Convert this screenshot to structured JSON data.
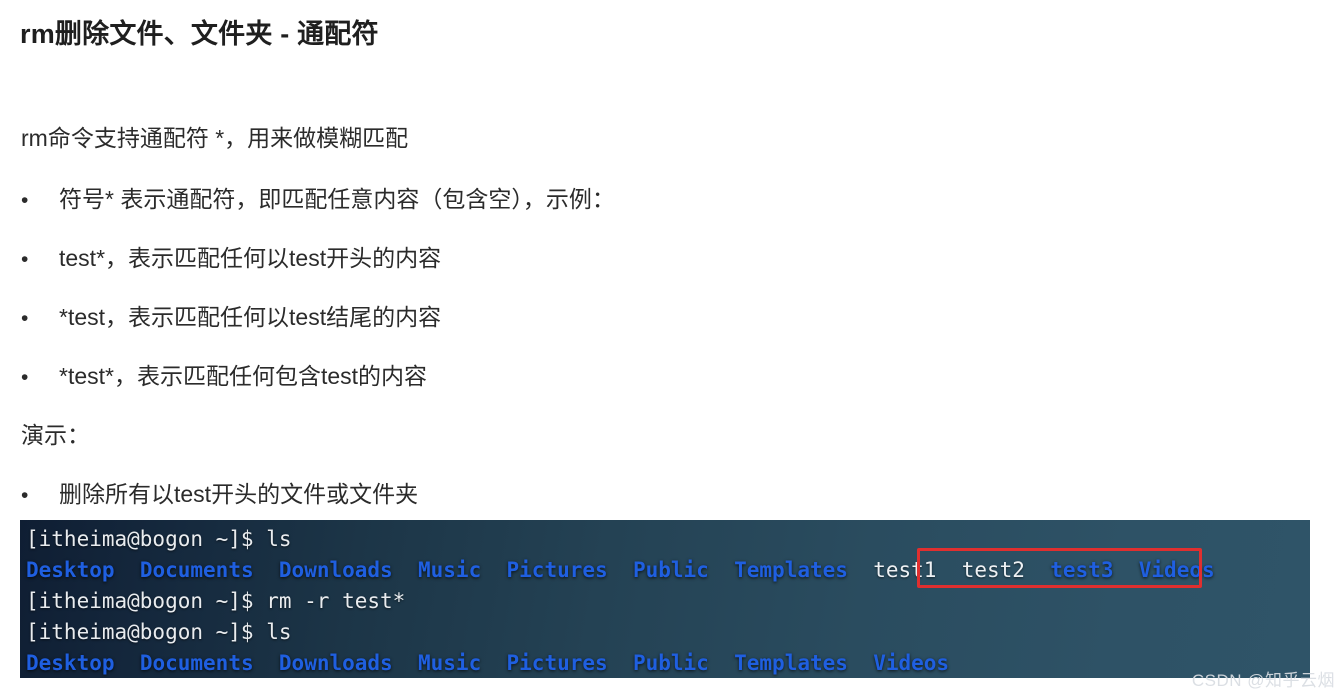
{
  "page": {
    "title": "rm删除文件、文件夹 - 通配符",
    "intro": "rm命令支持通配符 *，用来做模糊匹配",
    "bullets": [
      {
        "marker": "•",
        "text": "符号* 表示通配符，即匹配任意内容（包含空），示例："
      },
      {
        "marker": "•",
        "text": "test*，表示匹配任何以test开头的内容"
      },
      {
        "marker": "•",
        "text": "*test，表示匹配任何以test结尾的内容"
      },
      {
        "marker": "•",
        "text": "*test*，表示匹配任何包含test的内容"
      }
    ],
    "demo_label": "演示：",
    "demo_bullets": [
      {
        "marker": "•",
        "text": "删除所有以test开头的文件或文件夹"
      }
    ]
  },
  "terminal": {
    "prompt": "[itheima@bogon ~]$ ",
    "lines": [
      {
        "kind": "command",
        "prompt": "[itheima@bogon ~]$ ",
        "command": "ls"
      },
      {
        "kind": "listing",
        "entries": [
          {
            "name": "Desktop",
            "type": "dir"
          },
          {
            "name": "Documents",
            "type": "dir"
          },
          {
            "name": "Downloads",
            "type": "dir"
          },
          {
            "name": "Music",
            "type": "dir"
          },
          {
            "name": "Pictures",
            "type": "dir"
          },
          {
            "name": "Public",
            "type": "dir"
          },
          {
            "name": "Templates",
            "type": "dir"
          },
          {
            "name": "test1",
            "type": "file"
          },
          {
            "name": "test2",
            "type": "file"
          },
          {
            "name": "test3",
            "type": "dir"
          },
          {
            "name": "Videos",
            "type": "dir"
          }
        ]
      },
      {
        "kind": "command",
        "prompt": "[itheima@bogon ~]$ ",
        "command": "rm -r test*"
      },
      {
        "kind": "command",
        "prompt": "[itheima@bogon ~]$ ",
        "command": "ls"
      },
      {
        "kind": "listing",
        "entries": [
          {
            "name": "Desktop",
            "type": "dir"
          },
          {
            "name": "Documents",
            "type": "dir"
          },
          {
            "name": "Downloads",
            "type": "dir"
          },
          {
            "name": "Music",
            "type": "dir"
          },
          {
            "name": "Pictures",
            "type": "dir"
          },
          {
            "name": "Public",
            "type": "dir"
          },
          {
            "name": "Templates",
            "type": "dir"
          },
          {
            "name": "Videos",
            "type": "dir"
          }
        ]
      }
    ],
    "highlight": {
      "label": "test1 test2 test3",
      "color": "#e02f2f"
    }
  },
  "watermark": {
    "text": "CSDN @知乎云烟"
  },
  "colors": {
    "dir": "#1f5fe0",
    "file": "#eef1f4",
    "prompt": "#e9ecef",
    "terminal_bg_left": "#0f1e33",
    "terminal_bg_right": "#2f5468",
    "highlight": "#e02f2f",
    "body_text": "#2b2b2b"
  }
}
